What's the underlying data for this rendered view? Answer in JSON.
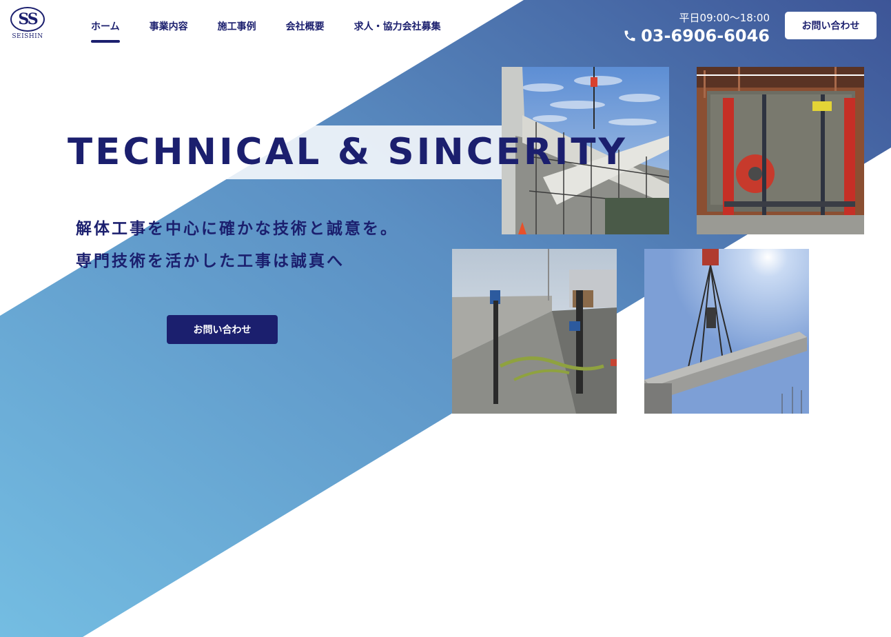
{
  "brand": {
    "logo_mark": "SS",
    "logo_text": "SEISHIN"
  },
  "nav": {
    "items": [
      {
        "label": "ホーム",
        "active": true
      },
      {
        "label": "事業内容"
      },
      {
        "label": "施工事例"
      },
      {
        "label": "会社概要"
      },
      {
        "label": "求人・協力会社募集"
      }
    ]
  },
  "contact": {
    "hours": "平日09:00〜18:00",
    "phone": "03-6906-6046",
    "cta_label": "お問い合わせ",
    "phone_icon": "phone-icon"
  },
  "hero": {
    "title": "TECHNICAL & SINCERITY",
    "line1": "解体工事を中心に確かな技術と誠意を。",
    "line2": "専門技術を活かした工事は誠真へ",
    "cta_label": "お問い合わせ"
  },
  "colors": {
    "navy": "#1b1f6e",
    "gradient_start": "#74bde2",
    "gradient_end": "#3f5a9a"
  }
}
